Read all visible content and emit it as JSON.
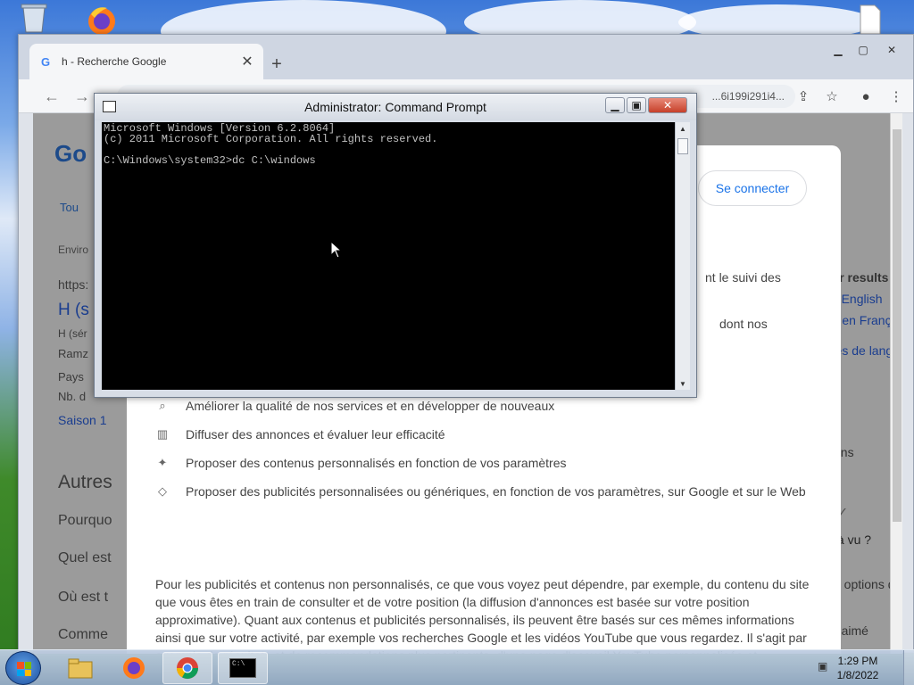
{
  "browser": {
    "tab_title": "h - Recherche Google",
    "tab_close": "✕",
    "new_tab": "+",
    "address_fragment": "...6i199i291i4...",
    "sign_in": "Se connecter"
  },
  "google_page_background": {
    "logo_fragment": "Go",
    "tab_fragment": "Tou",
    "environ_fragment": "Enviro",
    "https_fragment": "https:",
    "result_title_fragment": "H (s",
    "result_line1": "H (sér",
    "result_line2": "Ramz",
    "result_line3": "Pays",
    "result_line4": "Nb. d",
    "saison_link": "Saison 1",
    "autres_heading": "Autres",
    "faq": [
      "Pourquo",
      "Quel est",
      "Où est t",
      "Comme"
    ]
  },
  "consent": {
    "fragment_tracking": "nt le suivi des",
    "fragment_dont": "dont nos",
    "items": [
      {
        "icon": "search-icon",
        "text": "Améliorer la qualité de nos services et en développer de nouveaux"
      },
      {
        "icon": "chart-icon",
        "text": "Diffuser des annonces et évaluer leur efficacité"
      },
      {
        "icon": "sparkle-icon",
        "text": "Proposer des contenus personnalisés en fonction de vos paramètres"
      },
      {
        "icon": "tag-icon",
        "text": "Proposer des publicités personnalisées ou génériques, en fonction de vos paramètres, sur Google et sur le Web"
      }
    ],
    "paragraph": "Pour les publicités et contenus non personnalisés, ce que vous voyez peut dépendre, par exemple, du contenu du site que vous êtes en train de consulter et de votre position (la diffusion d'annonces est basée sur votre position approximative). Quant aux contenus et publicités personnalisés, ils peuvent être basés sur ces mêmes informations ainsi que sur votre activité, par exemple vos recherches Google et les vidéos YouTube que vous regardez. Il s'agit par exemple de résultats et de recommandations plus pertinents, d'une page d'accueil YouTube personnalisée et d'annonces publicitaires adaptées à vos centres d'intérêt."
  },
  "right_panel": {
    "results_in": "for results in",
    "to_english": "to English",
    "francais": "er en Français",
    "langue": "tres de langue",
    "sons": "sons",
    "deja_vu": "éjà vu ?",
    "options": "es options de l",
    "aime": "nt aimé"
  },
  "cmd": {
    "title": "Administrator: Command Prompt",
    "lines": [
      "Microsoft Windows [Version 6.2.8064]",
      "(c) 2011 Microsoft Corporation. All rights reserved.",
      "",
      "C:\\Windows\\system32>dc C:\\windows"
    ]
  },
  "taskbar": {
    "time": "1:29 PM",
    "date": "1/8/2022",
    "cmd_label": "C:\\"
  }
}
